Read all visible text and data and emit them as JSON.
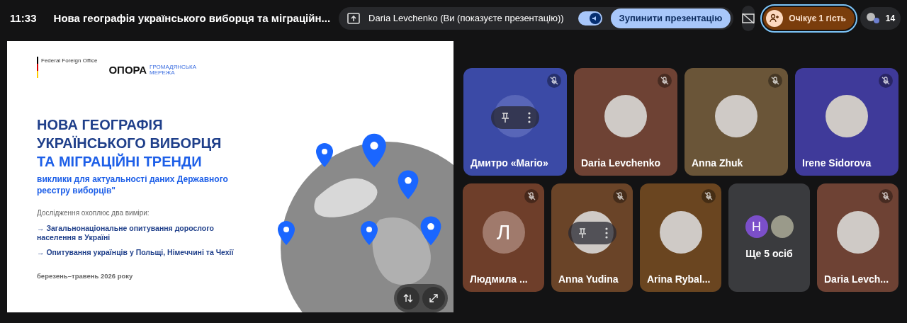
{
  "top_bar": {
    "time": "11:33",
    "title": "Нова географія українського виборця та міграційн...",
    "presenter": "Daria Levchenko (Ви (показуєте презентацію))",
    "audio_on": true,
    "stop_button": "Зупинити презентацію",
    "waiting_button": "Очікує 1 гість",
    "participants_count": "14"
  },
  "slide": {
    "sponsor": "Federal Foreign Office",
    "logo": "ОПОРА",
    "logo_tagline": "ГРОМАДЯНСЬКА МЕРЕЖА",
    "title_lines": [
      "НОВА ГЕОГРАФІЯ",
      "УКРАЇНСЬКОГО ВИБОРЦЯ",
      "ТА МІГРАЦІЙНІ ТРЕНДИ"
    ],
    "subtitle": "виклики для актуальності даних Державного реєстру виборців\"",
    "intro": "Дослідження охоплює два виміри:",
    "bullets": [
      "→ Загальнонаціональне опитування дорослого населення в Україні",
      "→ Опитування українців у Польщі, Німеччині та Чехії"
    ],
    "date": "березень–травень 2026 року"
  },
  "tiles": [
    {
      "name": "Дмитро «Mario»",
      "kind": "blank",
      "color": "#3b4aa6",
      "muted": true,
      "hover_controls": true
    },
    {
      "name": "Daria Levchenko",
      "kind": "photo",
      "color": "#6e4234",
      "muted": true,
      "hover_controls": false
    },
    {
      "name": "Anna Zhuk",
      "kind": "photo",
      "color": "#6a5538",
      "muted": true,
      "hover_controls": false
    },
    {
      "name": "Irene Sidorova",
      "kind": "photo",
      "color": "#3f3a9a",
      "muted": true,
      "hover_controls": false
    },
    {
      "name": "Людмила ...",
      "kind": "letter",
      "letter": "Л",
      "color": "#6e3e2a",
      "muted": true,
      "hover_controls": false
    },
    {
      "name": "Anna Yudina",
      "kind": "photo",
      "color": "#6a4428",
      "muted": true,
      "hover_controls": true
    },
    {
      "name": "Arina Rybal...",
      "kind": "photo",
      "color": "#6a4520",
      "muted": true,
      "hover_controls": false
    },
    {
      "name": "Ще 5 осіб",
      "kind": "more",
      "letter": "Н",
      "color": "#3a3b3e"
    },
    {
      "name": "Daria Levch...",
      "kind": "photo",
      "color": "#6e4234",
      "muted": true,
      "hover_controls": false
    }
  ]
}
